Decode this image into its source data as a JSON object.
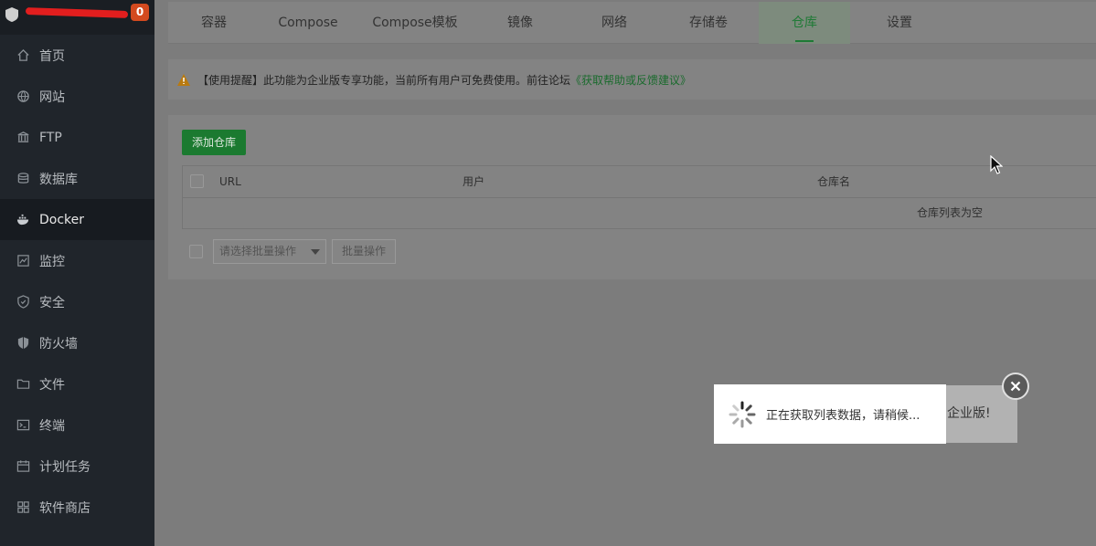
{
  "sidebar": {
    "badge": "0",
    "items": [
      {
        "label": "首页",
        "icon": "home-icon"
      },
      {
        "label": "网站",
        "icon": "globe-icon"
      },
      {
        "label": "FTP",
        "icon": "ftp-icon"
      },
      {
        "label": "数据库",
        "icon": "database-icon"
      },
      {
        "label": "Docker",
        "icon": "docker-icon",
        "active": true
      },
      {
        "label": "监控",
        "icon": "monitor-icon"
      },
      {
        "label": "安全",
        "icon": "shield-icon"
      },
      {
        "label": "防火墙",
        "icon": "firewall-icon"
      },
      {
        "label": "文件",
        "icon": "folder-icon"
      },
      {
        "label": "终端",
        "icon": "terminal-icon"
      },
      {
        "label": "计划任务",
        "icon": "calendar-icon"
      },
      {
        "label": "软件商店",
        "icon": "apps-icon"
      }
    ]
  },
  "tabs": [
    {
      "label": "容器"
    },
    {
      "label": "Compose"
    },
    {
      "label": "Compose模板"
    },
    {
      "label": "镜像"
    },
    {
      "label": "网络"
    },
    {
      "label": "存储卷"
    },
    {
      "label": "仓库",
      "active": true
    },
    {
      "label": "设置"
    }
  ],
  "notice": {
    "text": "【使用提醒】此功能为企业版专享功能，当前所有用户可免费使用。前往论坛",
    "link": "《获取帮助或反馈建议》"
  },
  "panel": {
    "add_button": "添加仓库",
    "columns": [
      "URL",
      "用户",
      "仓库名"
    ],
    "empty_text": "仓库列表为空",
    "bulk_placeholder": "请选择批量操作",
    "bulk_button": "批量操作"
  },
  "toast": {
    "loading_text": "正在获取列表数据，请稍候...",
    "background_text": "企业版!"
  },
  "colors": {
    "accent": "#20a53a",
    "sidebar_bg": "#20252b",
    "badge": "#d34a1f"
  }
}
